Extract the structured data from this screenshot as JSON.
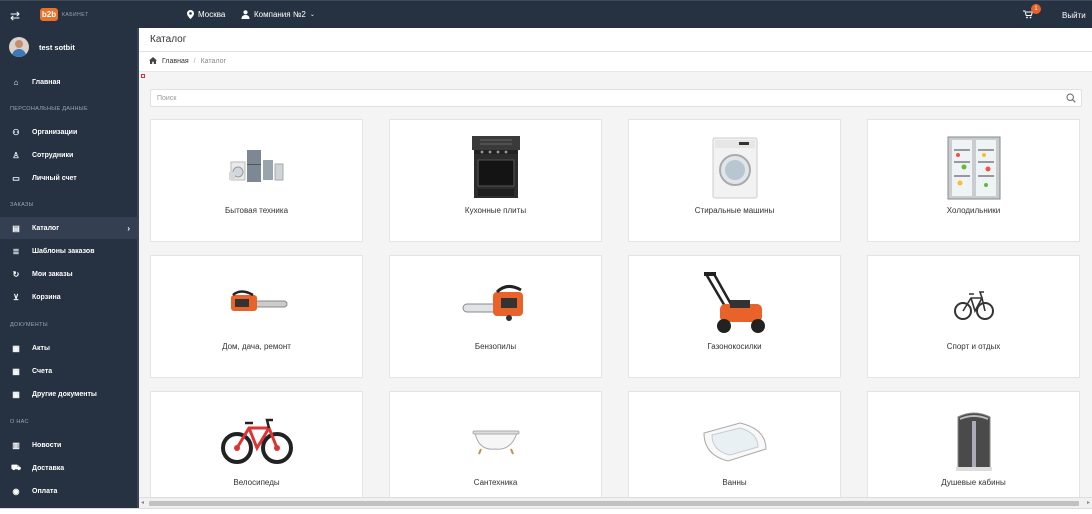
{
  "topbar": {
    "logo_text": "b2b",
    "logo_sub": "КАБИНЕТ",
    "city": "Москва",
    "company": "Компания №2",
    "cart_count": "1",
    "logout": "Выйти"
  },
  "sidebar": {
    "user_name": "test sotbit",
    "home": "Главная",
    "sections": {
      "personal": "ПЕРСОНАЛЬНЫЕ ДАННЫЕ",
      "orders": "ЗАКАЗЫ",
      "documents": "ДОКУМЕНТЫ",
      "about": "О НАС"
    },
    "personal_items": [
      "Организации",
      "Сотрудники",
      "Личный счет"
    ],
    "order_items": [
      "Каталог",
      "Шаблоны заказов",
      "Мои заказы",
      "Корзина"
    ],
    "document_items": [
      "Акты",
      "Счета",
      "Другие документы"
    ],
    "about_items": [
      "Новости",
      "Доставка",
      "Оплата"
    ]
  },
  "page": {
    "title": "Каталог",
    "breadcrumb": [
      "Главная",
      "Каталог"
    ],
    "search_placeholder": "Поиск"
  },
  "categories": [
    [
      "Бытовая техника",
      "Кухонные плиты",
      "Стиральные машины",
      "Холодильники"
    ],
    [
      "Дом, дача, ремонт",
      "Бензопилы",
      "Газонокосилки",
      "Спорт и отдых"
    ],
    [
      "Велосипеды",
      "Сантехника",
      "Ванны",
      "Душевые кабины"
    ]
  ],
  "colors": {
    "sidebar_bg": "#263241",
    "accent": "#e8722a",
    "badge": "#e8622a"
  }
}
